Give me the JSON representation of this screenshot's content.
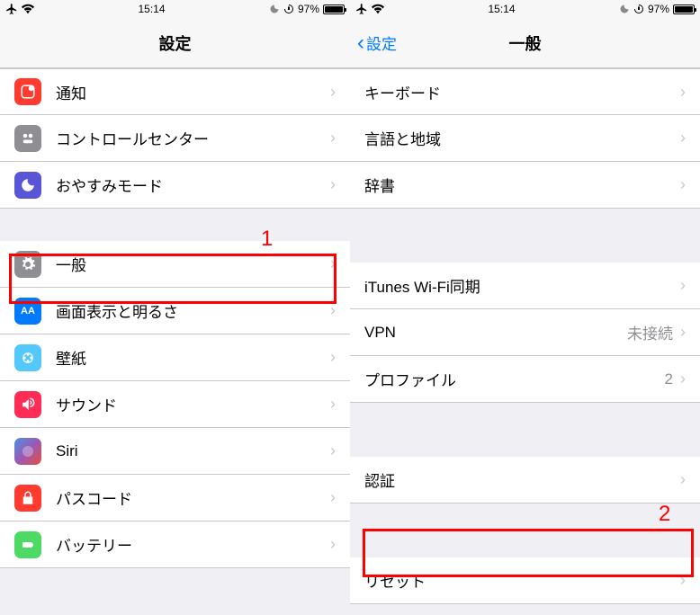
{
  "status": {
    "time": "15:14",
    "battery_pct": "97%"
  },
  "left": {
    "title": "設定",
    "group1": [
      {
        "key": "notification",
        "label": "通知"
      },
      {
        "key": "control",
        "label": "コントロールセンター"
      },
      {
        "key": "dnd",
        "label": "おやすみモード"
      }
    ],
    "group2": [
      {
        "key": "general",
        "label": "一般"
      },
      {
        "key": "display",
        "label": "画面表示と明るさ"
      },
      {
        "key": "wallpaper",
        "label": "壁紙"
      },
      {
        "key": "sound",
        "label": "サウンド"
      },
      {
        "key": "siri",
        "label": "Siri"
      },
      {
        "key": "passcode",
        "label": "パスコード"
      },
      {
        "key": "battery",
        "label": "バッテリー"
      }
    ]
  },
  "right": {
    "back": "設定",
    "title": "一般",
    "group1": [
      {
        "label": "キーボード"
      },
      {
        "label": "言語と地域"
      },
      {
        "label": "辞書"
      }
    ],
    "group2": [
      {
        "label": "iTunes Wi-Fi同期"
      },
      {
        "label": "VPN",
        "detail": "未接続"
      },
      {
        "label": "プロファイル",
        "detail": "2"
      }
    ],
    "group3": [
      {
        "label": "認証"
      }
    ],
    "group4": [
      {
        "label": "リセット"
      }
    ]
  },
  "annotations": {
    "a1": "1",
    "a2": "2"
  }
}
